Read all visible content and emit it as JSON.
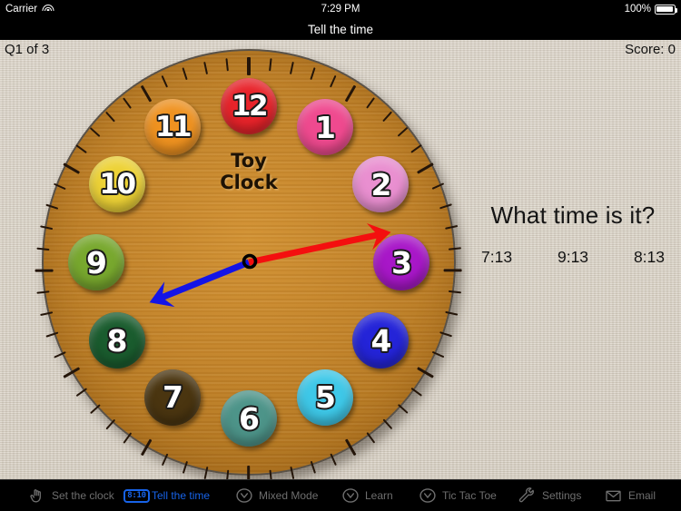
{
  "status_bar": {
    "carrier": "Carrier",
    "wifi_icon": "wifi-icon",
    "time": "7:29 PM",
    "battery_percent": "100%",
    "battery_icon": "battery-full-icon"
  },
  "nav_bar": {
    "title": "Tell the time"
  },
  "question_header": {
    "progress": "Q1 of 3",
    "score": "Score: 0"
  },
  "clock": {
    "brand": "Toy\nClock",
    "numbers": [
      {
        "label": "12",
        "color": "#e8232a"
      },
      {
        "label": "1",
        "color": "#ef4a8f"
      },
      {
        "label": "2",
        "color": "#e98fd0"
      },
      {
        "label": "3",
        "color": "#a817c8"
      },
      {
        "label": "4",
        "color": "#2424d8"
      },
      {
        "label": "5",
        "color": "#3ec8e8"
      },
      {
        "label": "6",
        "color": "#4d9489"
      },
      {
        "label": "7",
        "color": "#4a3510"
      },
      {
        "label": "8",
        "color": "#1a5c2e"
      },
      {
        "label": "9",
        "color": "#78a82e"
      },
      {
        "label": "10",
        "color": "#edd236"
      },
      {
        "label": "11",
        "color": "#ef9220"
      }
    ],
    "hour_hand": {
      "name": "hour-hand",
      "color": "#1414e6",
      "angle_deg": 248,
      "length": 118
    },
    "minute_hand": {
      "name": "minute-hand",
      "color": "#f40f0f",
      "angle_deg": 78,
      "length": 160
    },
    "center_pin_color": "#000000",
    "face_color": "#c3842a",
    "displayed_time": "8:13"
  },
  "question_panel": {
    "question": "What time is it?",
    "answers": [
      "7:13",
      "9:13",
      "8:13"
    ]
  },
  "toolbar": {
    "items": [
      {
        "label": "Set the clock",
        "icon": "hand-pointer-icon",
        "active": false
      },
      {
        "label": "Tell the time",
        "icon": "digital-clock-badge-icon",
        "badge": "8:10",
        "active": true
      },
      {
        "label": "Mixed Mode",
        "icon": "clock-face-icon",
        "active": false
      },
      {
        "label": "Learn",
        "icon": "clock-face-icon",
        "active": false
      },
      {
        "label": "Tic Tac Toe",
        "icon": "clock-face-icon",
        "active": false
      },
      {
        "label": "Settings",
        "icon": "wrench-icon",
        "active": false
      },
      {
        "label": "Email",
        "icon": "envelope-icon",
        "active": false
      }
    ],
    "active_color": "#1763e8",
    "inactive_color": "#6e6e6e"
  }
}
